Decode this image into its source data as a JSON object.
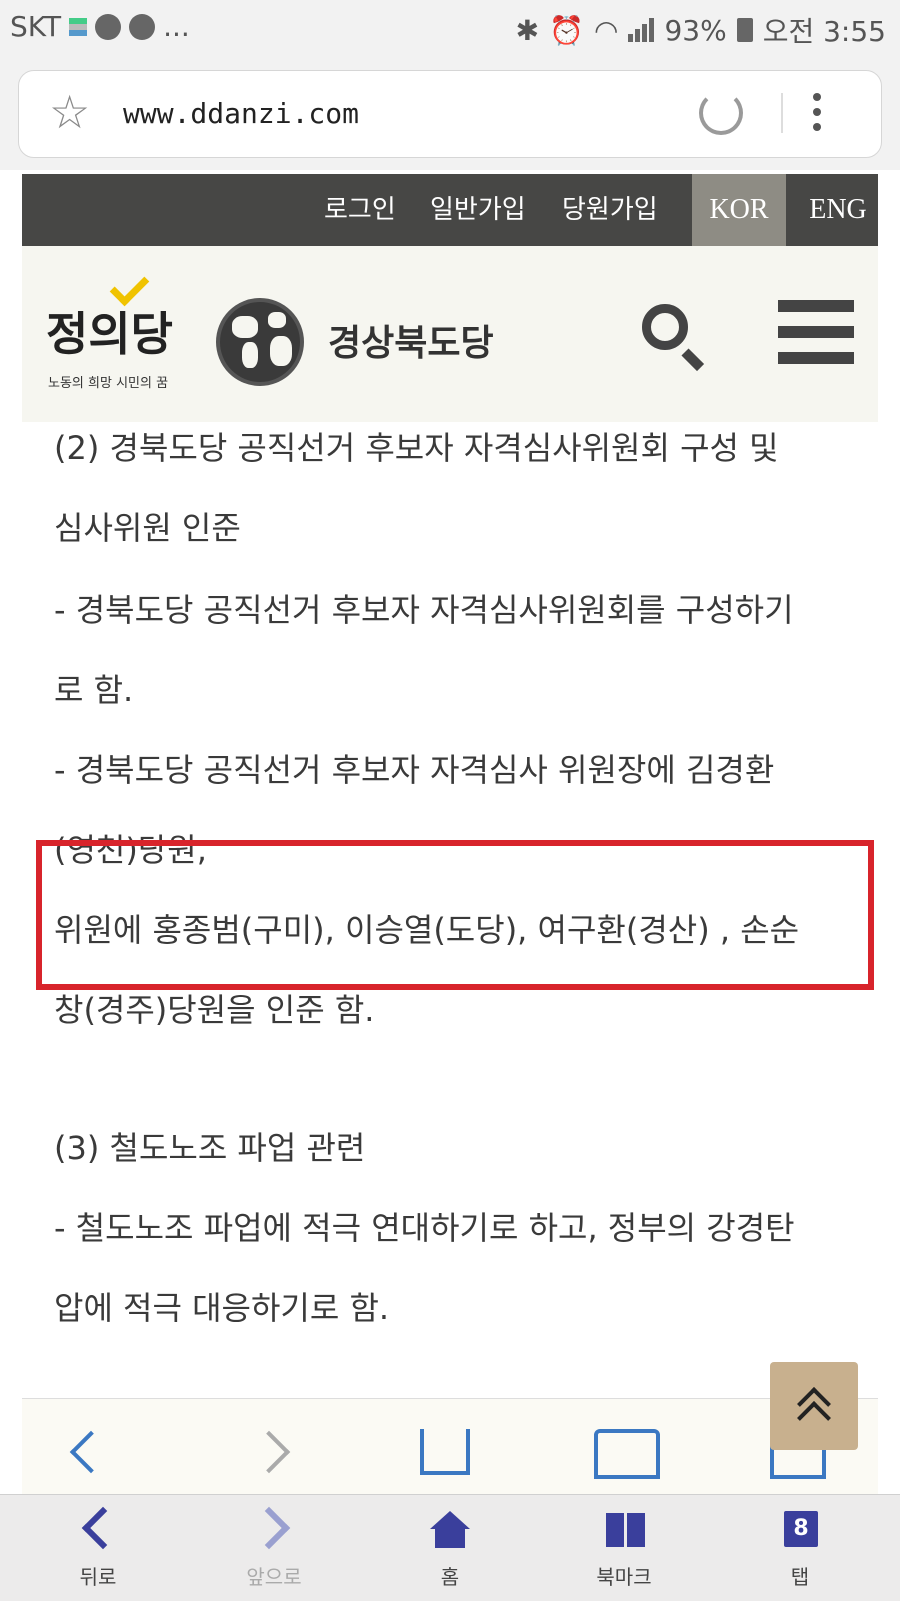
{
  "status_bar": {
    "carrier": "SKT",
    "more": "...",
    "battery": "93%",
    "time": "오전 3:55"
  },
  "browser": {
    "url": "www.ddanzi.com",
    "bottom_nav": [
      {
        "label": "뒤로",
        "icon": "back-chevron-icon"
      },
      {
        "label": "앞으로",
        "icon": "forward-chevron-icon"
      },
      {
        "label": "홈",
        "icon": "home-icon"
      },
      {
        "label": "북마크",
        "icon": "bookmark-icon"
      },
      {
        "label": "탭",
        "icon": "tabs-icon",
        "count": "8"
      }
    ]
  },
  "site": {
    "top_nav": [
      "로그인",
      "일반가입",
      "당원가입"
    ],
    "lang": {
      "kor": "KOR",
      "eng": "ENG"
    },
    "logo": {
      "main": "정의당",
      "sub": "노동의 희망 시민의 꿈"
    },
    "title": "경상북도당",
    "accent_color": "#d8242b"
  },
  "article": {
    "lines": [
      "(2) 경북도당 공직선거 후보자 자격심사위원회 구성 및",
      "심사위원 인준",
      "- 경북도당 공직선거 후보자 자격심사위원회를 구성하기",
      "로 함.",
      "- 경북도당 공직선거 후보자 자격심사 위원장에 김경환",
      "(영천)당원,",
      "위원에 홍종범(구미), 이승열(도당), 여구환(경산) , 손순",
      "창(경주)당원을 인준 함.",
      "(3) 철도노조 파업 관련",
      "- 철도노조 파업에 적극 연대하기로 하고, 정부의 강경탄",
      "압에 적극 대응하기로 함."
    ]
  }
}
